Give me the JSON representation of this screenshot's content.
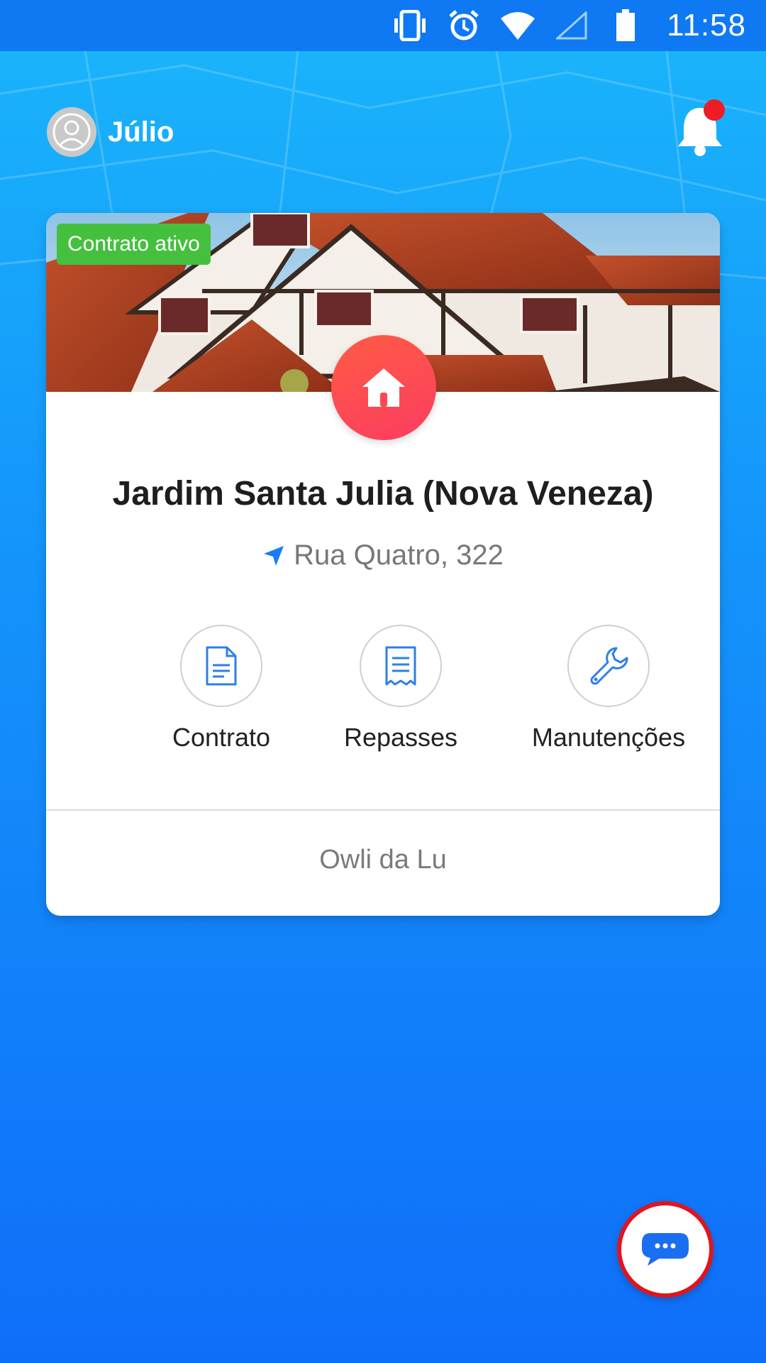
{
  "status_bar": {
    "time": "11:58",
    "icons": [
      "vibrate-icon",
      "alarm-icon",
      "wifi-icon",
      "signal-icon",
      "battery-icon"
    ]
  },
  "header": {
    "user_name": "Júlio",
    "has_notification": true
  },
  "property_card": {
    "status_badge": "Contrato ativo",
    "title": "Jardim Santa Julia (Nova Veneza)",
    "address": "Rua Quatro, 322",
    "actions": [
      {
        "label": "Contrato",
        "icon": "document-icon"
      },
      {
        "label": "Repasses",
        "icon": "receipt-icon"
      },
      {
        "label": "Manutenções",
        "icon": "wrench-icon"
      }
    ],
    "footer": "Owli da Lu"
  },
  "colors": {
    "background_top": "#1ab6fb",
    "background_bottom": "#0f6ef9",
    "status_bar": "#0f78f3",
    "badge_green": "#45c03e",
    "home_red": "#fb3d60",
    "accent_blue": "#1a7cf0",
    "notification_red": "#ee1c24"
  }
}
